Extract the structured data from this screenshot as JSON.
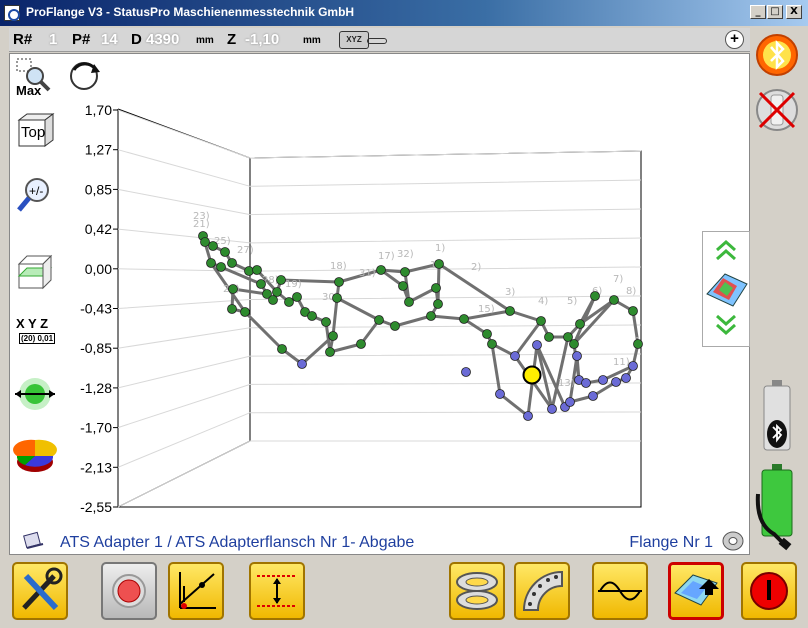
{
  "window": {
    "title": "ProFlange V3 - StatusPro Maschienenmesstechnik GmbH",
    "min": "_",
    "max": "□",
    "close": "X"
  },
  "status": {
    "r_label": "R#",
    "r_value": "1",
    "p_label": "P#",
    "p_value": "14",
    "d_label": "D",
    "d_value": "4390",
    "d_unit": "mm",
    "z_label": "Z",
    "z_value": "-1,10",
    "z_unit": "mm",
    "xyz_badge": "XYZ",
    "plus": "+"
  },
  "tools": {
    "max_label": "Max",
    "top_label": "Top",
    "xyz_label": "X Y Z",
    "xyz_sub": "(20) 0,01"
  },
  "footer": {
    "adapter": "ATS Adapter 1 / ATS Adapterflansch Nr 1- Abgabe",
    "flange": "Flange Nr 1"
  },
  "colors": {
    "accent_yellow": "#f5c400",
    "point_green": "#2e8b2e",
    "point_blue": "#6b6bd6",
    "selected_point": "#ffee00",
    "text_blue": "#1f3f9f"
  },
  "chart_data": {
    "type": "scatter",
    "y_ticks": [
      "1,70",
      "1,27",
      "0,85",
      "0,42",
      "0,00",
      "-0,43",
      "-0,85",
      "-1,28",
      "-1,70",
      "-2,13",
      "-2,55"
    ],
    "ylim": [
      -2.55,
      1.7
    ],
    "point_labels": [
      "23)",
      "21)",
      "25)",
      "27)",
      "28)",
      "19)",
      "21)",
      "18)",
      "31)",
      "17)",
      "32)",
      "1)",
      "1)",
      "2)",
      "30)",
      "15)",
      "3)",
      "4)",
      "5)",
      "6)",
      "7)",
      "8)",
      "13)",
      "11)",
      "1"
    ]
  }
}
